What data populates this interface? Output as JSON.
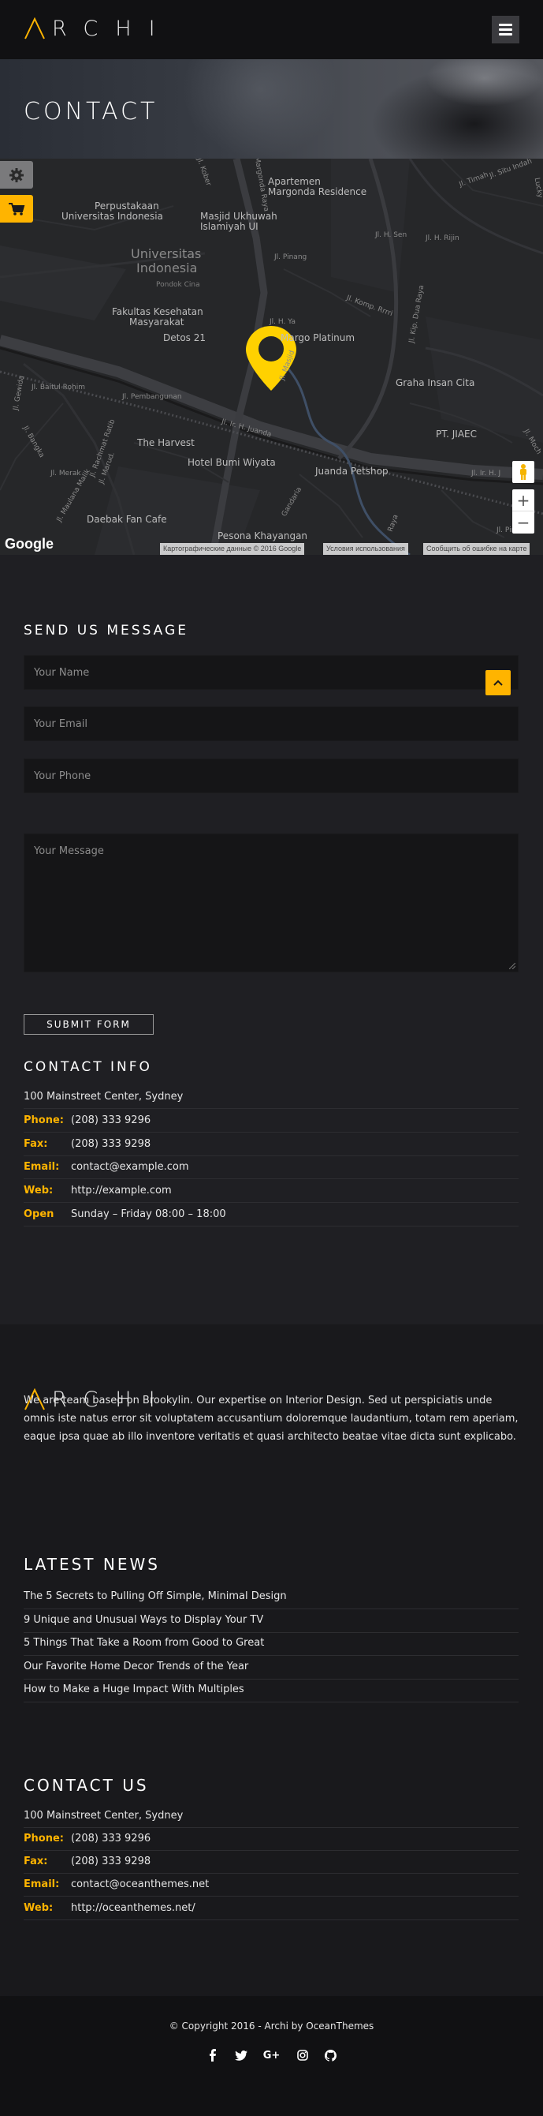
{
  "header": {
    "logo_text": "RCHI",
    "logo_letter": "A"
  },
  "page_title": "CONTACT",
  "map": {
    "labels": {
      "apartemen": "Apartemen",
      "margonda": "Margonda Residence",
      "perpustakaan": "Perpustakaan",
      "ui_lib": "Universitas Indonesia",
      "masjid": "Masjid Ukhuwah",
      "islamiyah": "Islamiyah UI",
      "ui_big1": "Universitas",
      "ui_big2": "Indonesia",
      "pondok": "Pondok Cina",
      "fakultas1": "Fakultas Kesehatan",
      "fakultas2": "Masyarakat",
      "detos": "Detos 21",
      "margo": "Margo Platinum",
      "graha": "Graha Insan Cita",
      "ptjiaec": "PT. JIAEC",
      "harvest": "The Harvest",
      "bumi": "Hotel Bumi Wiyata",
      "juanda": "Juanda Petshop",
      "daebak": "Daebak Fan Cafe",
      "pesona": "Pesona Khayangan",
      "st_pinang": "Jl. Pinang",
      "st_komp": "Jl. Komp. Rrrri",
      "st_hsen": "Jl. H. Sen",
      "st_hrijin": "Jl. H. Rijin",
      "st_baitul": "Jl. Baitul Rohim",
      "st_pembangunan": "Jl. Pembangunan",
      "st_juanda": "Jl. Ir. H. Juanda",
      "st_merak": "Jl. Merak",
      "st_gewida": "Jl. Gewida",
      "st_timah": "Jl. Timah",
      "st_situ": "Jl. Situ Indah",
      "st_lucky": "Lucky",
      "st_kip": "Jl. Kip. Dua Raya",
      "st_pinus": "Jl. Pinus",
      "st_gdang": "Gandaria",
      "st_irhj": "Jl. Ir. H. J",
      "st_moch": "Jl. Moch",
      "st_raya": "Raya",
      "st_bangka": "Jl. Bangka",
      "st_rahdat": "Jl. Rachmat Ratib",
      "st_marudi": "Jl. Marud.",
      "st_maulana": "Jl. Maulana Malik",
      "st_kober": "Jl. Kober",
      "st_margo": "Jl. Margonda Raya",
      "st_ymq": "Jl. H. Ya",
      "st_masjid": "Jl. Masjid"
    },
    "google": "Google",
    "attrib_data": "Картографические данные © 2016 Google",
    "attrib_terms": "Условия использования",
    "attrib_report": "Сообщить об ошибке на карте",
    "zoom_in": "+",
    "zoom_out": "−"
  },
  "form": {
    "heading": "SEND US MESSAGE",
    "name_placeholder": "Your Name",
    "email_placeholder": "Your Email",
    "phone_placeholder": "Your Phone",
    "message_placeholder": "Your Message",
    "submit": "SUBMIT FORM"
  },
  "contact_info": {
    "heading": "CONTACT INFO",
    "address": "100 Mainstreet Center, Sydney",
    "rows": [
      {
        "key": "Phone:",
        "value": "(208) 333 9296"
      },
      {
        "key": "Fax:",
        "value": "(208) 333 9298"
      },
      {
        "key": "Email:",
        "value": "contact@example.com"
      },
      {
        "key": "Web:",
        "value": "http://example.com"
      },
      {
        "key": "Open",
        "value": "Sunday – Friday 08:00 – 18:00"
      }
    ]
  },
  "footer": {
    "logo_text": "RCHI",
    "logo_letter": "A",
    "about": "We are team based on Brookylin. Our expertise on Interior Design. Sed ut perspiciatis unde omnis iste natus error sit voluptatem accusantium doloremque laudantium, totam rem aperiam, eaque ipsa quae ab illo inventore veritatis et quasi architecto beatae vitae dicta sunt explicabo.",
    "news_heading": "LATEST NEWS",
    "news": [
      "The 5 Secrets to Pulling Off Simple, Minimal Design",
      "9 Unique and Unusual Ways to Display Your TV",
      "5 Things That Take a Room from Good to Great",
      "Our Favorite Home Decor Trends of the Year",
      "How to Make a Huge Impact With Multiples"
    ],
    "contact_heading": "CONTACT US",
    "address": "100 Mainstreet Center, Sydney",
    "rows": [
      {
        "key": "Phone:",
        "value": "(208) 333 9296"
      },
      {
        "key": "Fax:",
        "value": "(208) 333 9298"
      },
      {
        "key": "Email:",
        "value": "contact@oceanthemes.net"
      },
      {
        "key": "Web:",
        "value": "http://oceanthemes.net/"
      }
    ]
  },
  "bottom": {
    "copyright": "© Copyright 2016 - Archi by OceanThemes",
    "socials": [
      "facebook-icon",
      "twitter-icon",
      "google-plus-icon",
      "instagram-icon",
      "github-icon"
    ]
  },
  "colors": {
    "accent": "#ffb400",
    "background": "#1f1f23",
    "header": "#111113"
  }
}
